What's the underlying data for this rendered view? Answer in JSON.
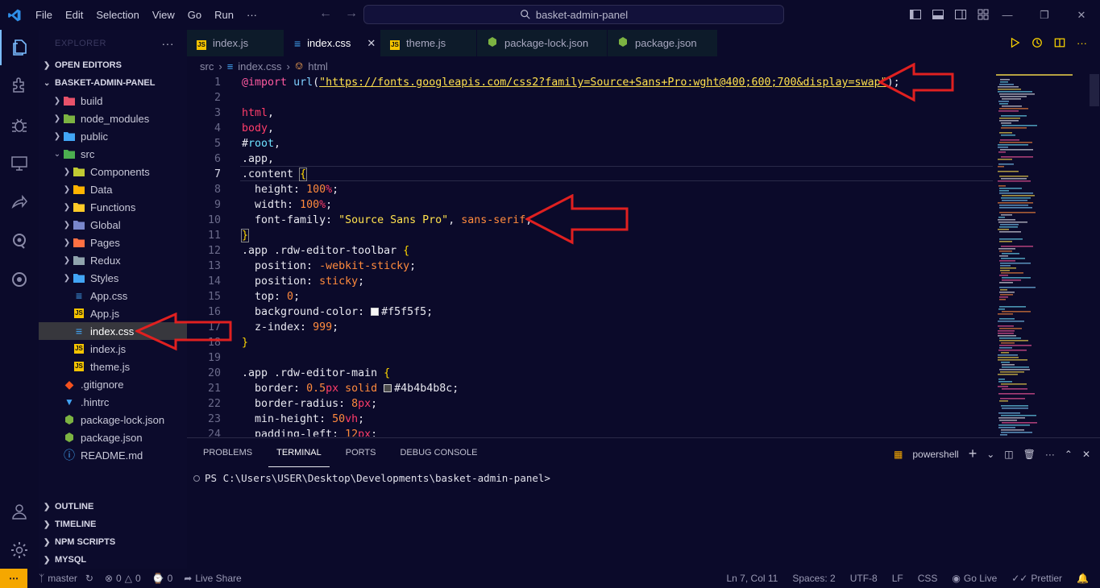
{
  "menu": [
    "File",
    "Edit",
    "Selection",
    "View",
    "Go",
    "Run",
    "···"
  ],
  "search": {
    "text": "basket-admin-panel"
  },
  "sidebar": {
    "title": "EXPLORER",
    "open_editors": "OPEN EDITORS",
    "project": "BASKET-ADMIN-PANEL",
    "tree": [
      {
        "label": "build",
        "depth": 1,
        "type": "folder",
        "color": "#e8526a"
      },
      {
        "label": "node_modules",
        "depth": 1,
        "type": "folder",
        "color": "#7cb342"
      },
      {
        "label": "public",
        "depth": 1,
        "type": "folder",
        "color": "#42a5f5"
      },
      {
        "label": "src",
        "depth": 1,
        "type": "folder-open",
        "color": "#4caf50"
      },
      {
        "label": "Components",
        "depth": 2,
        "type": "folder",
        "color": "#c0ca33"
      },
      {
        "label": "Data",
        "depth": 2,
        "type": "folder",
        "color": "#ffb300"
      },
      {
        "label": "Functions",
        "depth": 2,
        "type": "folder",
        "color": "#ffca28"
      },
      {
        "label": "Global",
        "depth": 2,
        "type": "folder",
        "color": "#7986cb"
      },
      {
        "label": "Pages",
        "depth": 2,
        "type": "folder",
        "color": "#ff7043"
      },
      {
        "label": "Redux",
        "depth": 2,
        "type": "folder",
        "color": "#90a4ae"
      },
      {
        "label": "Styles",
        "depth": 2,
        "type": "folder",
        "color": "#42a5f5"
      },
      {
        "label": "App.css",
        "depth": 2,
        "type": "css"
      },
      {
        "label": "App.js",
        "depth": 2,
        "type": "js"
      },
      {
        "label": "index.css",
        "depth": 2,
        "type": "css",
        "selected": true
      },
      {
        "label": "index.js",
        "depth": 2,
        "type": "js"
      },
      {
        "label": "theme.js",
        "depth": 2,
        "type": "js"
      },
      {
        "label": ".gitignore",
        "depth": 1,
        "type": "git"
      },
      {
        "label": ".hintrc",
        "depth": 1,
        "type": "hint"
      },
      {
        "label": "package-lock.json",
        "depth": 1,
        "type": "npm"
      },
      {
        "label": "package.json",
        "depth": 1,
        "type": "npm"
      },
      {
        "label": "README.md",
        "depth": 1,
        "type": "info"
      }
    ],
    "bottom_sections": [
      "OUTLINE",
      "TIMELINE",
      "NPM SCRIPTS",
      "MYSQL"
    ]
  },
  "tabs": [
    {
      "label": "index.js",
      "type": "js"
    },
    {
      "label": "index.css",
      "type": "css",
      "active": true
    },
    {
      "label": "theme.js",
      "type": "js"
    },
    {
      "label": "package-lock.json",
      "type": "npm"
    },
    {
      "label": "package.json",
      "type": "npm"
    }
  ],
  "breadcrumb": {
    "folder": "src",
    "file": "index.css",
    "symbol": "html"
  },
  "editor": {
    "current_line": 7,
    "lines": [
      "<span class='tk-kw'>@import</span> <span class='tk-fn'>url</span>(<span class='tk-str' style='text-decoration:underline'>\"https://fonts.googleapis.com/css2?family=Source+Sans+Pro:wght@400;600;700&display=swap\"</span>);",
      "",
      "<span class='tk-sel'>html</span>,",
      "<span class='tk-sel'>body</span>,",
      "#<span class='tk-id'>root</span>,",
      ".app,",
      ".content <span class='tk-brace' style='outline:1px solid #888'>{</span>",
      "  height: <span class='tk-val'>100</span><span class='tk-unit'>%</span>;",
      "  width: <span class='tk-val'>100</span><span class='tk-unit'>%</span>;",
      "  font-family: <span class='tk-str'>\"Source Sans Pro\"</span>, <span class='tk-val'>sans-serif</span>;",
      "<span class='tk-brace' style='outline:1px solid #888'>}</span>",
      ".app .rdw-editor-toolbar <span class='tk-brace'>{</span>",
      "  position: <span class='tk-val'>-webkit-sticky</span>;",
      "  position: <span class='tk-val'>sticky</span>;",
      "  top: <span class='tk-val'>0</span>;",
      "  background-color: <span class='swatch' style='background:#f5f5f5'></span>#f5f5f5;",
      "  z-index: <span class='tk-val'>999</span>;",
      "<span class='tk-brace'>}</span>",
      "",
      ".app .rdw-editor-main <span class='tk-brace'>{</span>",
      "  border: <span class='tk-val'>0.5</span><span class='tk-unit'>px</span> <span class='tk-val'>solid</span> <span class='swatch' style='background:#4b4b4b'></span>#4b4b4b8c;",
      "  border-radius: <span class='tk-val'>8</span><span class='tk-unit'>px</span>;",
      "  min-height: <span class='tk-val'>50</span><span class='tk-unit'>vh</span>;",
      "  padding-left: <span class='tk-val'>12</span><span class='tk-unit'>px</span>;"
    ]
  },
  "panel": {
    "tabs": [
      "PROBLEMS",
      "TERMINAL",
      "PORTS",
      "DEBUG CONSOLE"
    ],
    "active_tab": "TERMINAL",
    "shell": "powershell",
    "prompt": "PS C:\\Users\\USER\\Desktop\\Developments\\basket-admin-panel>"
  },
  "status": {
    "branch": "master",
    "errors": "0",
    "warnings": "0",
    "ports": "0",
    "liveshare": "Live Share",
    "position": "Ln 7, Col 11",
    "spaces": "Spaces: 2",
    "encoding": "UTF-8",
    "eol": "LF",
    "language": "CSS",
    "golive": "Go Live",
    "prettier": "Prettier"
  }
}
